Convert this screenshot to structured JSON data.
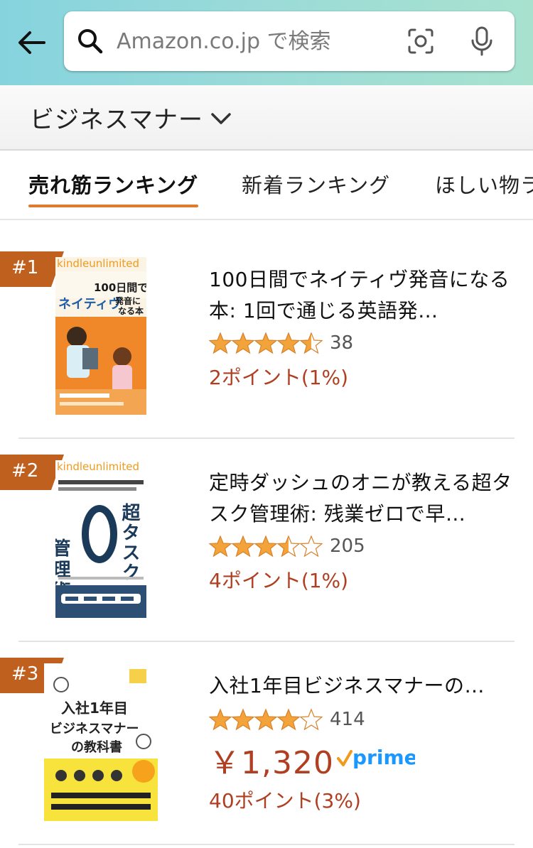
{
  "search": {
    "placeholder": "Amazon.co.jp で検索"
  },
  "category": {
    "label": "ビジネスマナー"
  },
  "tabs": [
    {
      "label": "売れ筋ランキング",
      "active": true
    },
    {
      "label": "新着ランキング",
      "active": false
    },
    {
      "label": "ほしい物ラ",
      "active": false
    }
  ],
  "items": [
    {
      "rank": "#1",
      "title": "100日間でネイティヴ発音になる本: 1回で通じる英語発…",
      "rating": 4.5,
      "review_count": "38",
      "points": "2ポイント(1%)",
      "cover": {
        "badge": "kindleunlimited",
        "title_line1": "100日間で",
        "title_line2": "ネイティヴ",
        "title_line3": "発音に",
        "title_line4": "なる本"
      }
    },
    {
      "rank": "#2",
      "title": "定時ダッシュのオニが教える超タスク管理術: 残業ゼロで早…",
      "rating": 3.5,
      "review_count": "205",
      "points": "4ポイント(1%)",
      "cover": {
        "badge": "kindleunlimited",
        "title_line1": "管理術",
        "title_line2": "超タスク"
      }
    },
    {
      "rank": "#3",
      "title": "入社1年目ビジネスマナーの…",
      "rating": 4.0,
      "review_count": "414",
      "price": "￥1,320",
      "prime": "prime",
      "points": "40ポイント(3%)",
      "cover": {
        "title_line1": "入社1年目",
        "title_line2": "ビジネスマナー",
        "title_line3": "の教科書"
      }
    }
  ],
  "colors": {
    "accent_orange": "#e07a2e",
    "rank_badge": "#c0601f",
    "star_fill": "#f2a33a",
    "price_red": "#b03f22",
    "prime_blue": "#1a98ff"
  },
  "icons": [
    "back-arrow-icon",
    "search-icon",
    "camera-icon",
    "microphone-icon",
    "chevron-down-icon",
    "star-icon",
    "prime-check-icon"
  ]
}
